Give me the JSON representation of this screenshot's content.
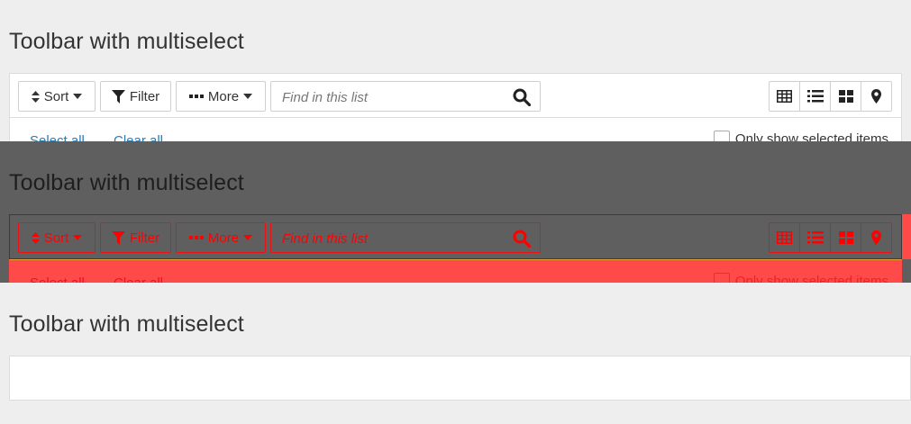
{
  "title": "Toolbar with multiselect",
  "toolbar": {
    "sort_label": "Sort",
    "filter_label": "Filter",
    "more_label": "More",
    "search_placeholder": "Find in this list"
  },
  "selection": {
    "select_all": "Select all",
    "clear_all": "Clear all",
    "only_show_selected": "Only show selected items"
  },
  "views": [
    "table-view",
    "list-view",
    "tile-view",
    "map-view"
  ],
  "colors": {
    "page_bg": "#eeeeee",
    "overlay_bg": "#5f5f5f",
    "highlight_red": "#ff4a4a",
    "outline_red": "#ff0000",
    "link_blue": "#2b7bb0"
  }
}
